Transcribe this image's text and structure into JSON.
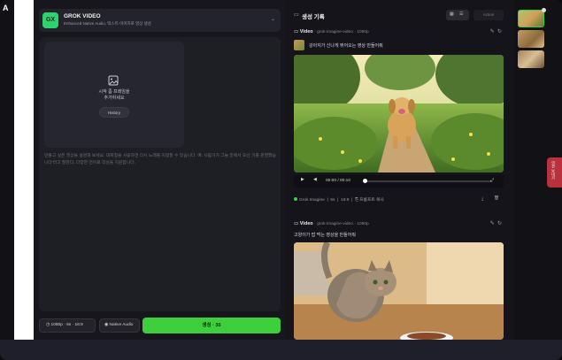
{
  "app": {
    "logo": "A"
  },
  "generator": {
    "badge": "GX",
    "title": "GROK VIDEO",
    "subtitle": "Enhanced Native Audio, 텍스트-이미지로 영상 생성",
    "upload_text_line1": "시작 좀 프레임을",
    "upload_text_line2": "추가하세요",
    "history_label": "History",
    "prompt_placeholder": "만들고 싶은 영상을 설명해 보세요. 대화형을 사용하면 다시 노래를 지정할 수 있습니다. 예: 사람가가 그늘 밑에서 오선 기를 운영했습니다'라고 말한다. 다양한 언어로 작성을 지원합니다.",
    "settings_label": "1080p · 5s · 16:9",
    "audio_label": "Native Audio",
    "generate_label": "생성 · 35"
  },
  "history": {
    "title": "생성 기록",
    "grid_icon": "grid-icon",
    "list_icon": "list-icon",
    "action_label": "Action",
    "items": [
      {
        "type": "Video",
        "model": "grok-imagine-video",
        "resolution": "1080p",
        "caption": "강아지가 신나게 뛰어오는 영상 만들어줘",
        "time": "00:00 / 00:10",
        "provider": "Grok Imagine",
        "duration": "5s",
        "ratio": "16:9",
        "copy_label": "프롬프트 복사"
      },
      {
        "type": "Video",
        "model": "grok-imagine-video",
        "resolution": "1080p",
        "caption": "고양이가 밥 먹는 영상을 만들어줘"
      }
    ]
  },
  "side_tab": {
    "label": "의견 보내기"
  },
  "colors": {
    "accent_green": "#3ecf3e",
    "panel_bg": "#1e1e25",
    "side_tab": "#b8323d"
  }
}
